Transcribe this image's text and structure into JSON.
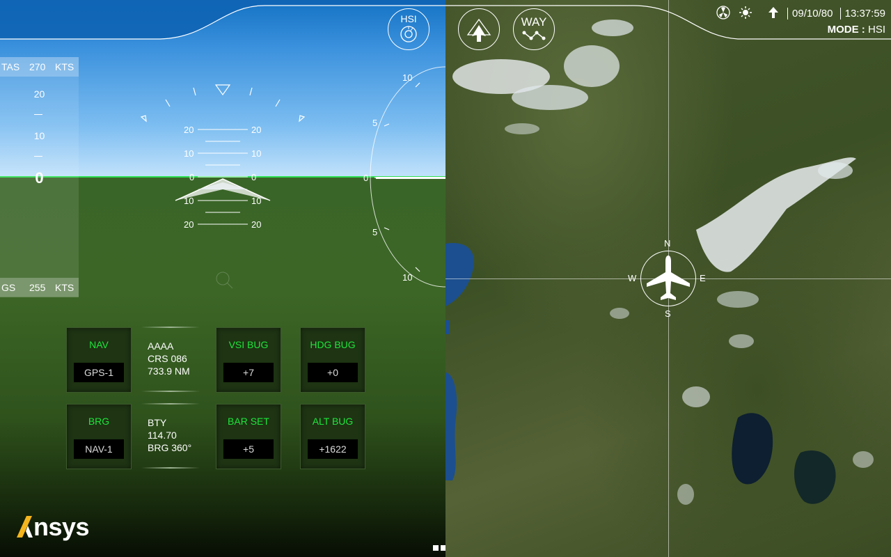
{
  "pfd": {
    "tas_label": "TAS",
    "tas_value": "270",
    "tas_unit": "KTS",
    "gs_label": "GS",
    "gs_value": "255",
    "gs_unit": "KTS",
    "speed_tape": {
      "upper": "20",
      "mid": "10",
      "current": "0"
    },
    "pitch_labels": {
      "p20": "20",
      "p10": "10",
      "p0": "0"
    },
    "vsi_labels": {
      "top": "10",
      "upper": "5",
      "zero": "0",
      "lower": "5",
      "bottom": "10"
    },
    "hsi_button_label": "HSI",
    "panels": {
      "nav": {
        "title": "NAV",
        "value": "GPS-1"
      },
      "vsi_bug": {
        "title": "VSI BUG",
        "value": "+7"
      },
      "hdg_bug": {
        "title": "HDG BUG",
        "value": "+0"
      },
      "brg": {
        "title": "BRG",
        "value": "NAV-1"
      },
      "bar_set": {
        "title": "BAR SET",
        "value": "+5"
      },
      "alt_bug": {
        "title": "ALT BUG",
        "value": "+1622"
      }
    },
    "nav_info": {
      "line1": "AAAA",
      "line2": "CRS 086",
      "line3": "733.9 NM"
    },
    "brg_info": {
      "line1": "BTY",
      "line2": "114.70",
      "line3": "BRG 360°"
    },
    "logo_text": "nsys",
    "colors": {
      "accent_green": "#1fe53c",
      "horizon_green": "#2ee052",
      "logo_yellow": "#f5b51e"
    }
  },
  "map": {
    "way_button_label": "WAY",
    "date": "09/10/80",
    "time": "13:37:59",
    "mode_label": "MODE :",
    "mode_value": "HSI",
    "compass": {
      "n": "N",
      "s": "S",
      "e": "E",
      "w": "W"
    }
  }
}
